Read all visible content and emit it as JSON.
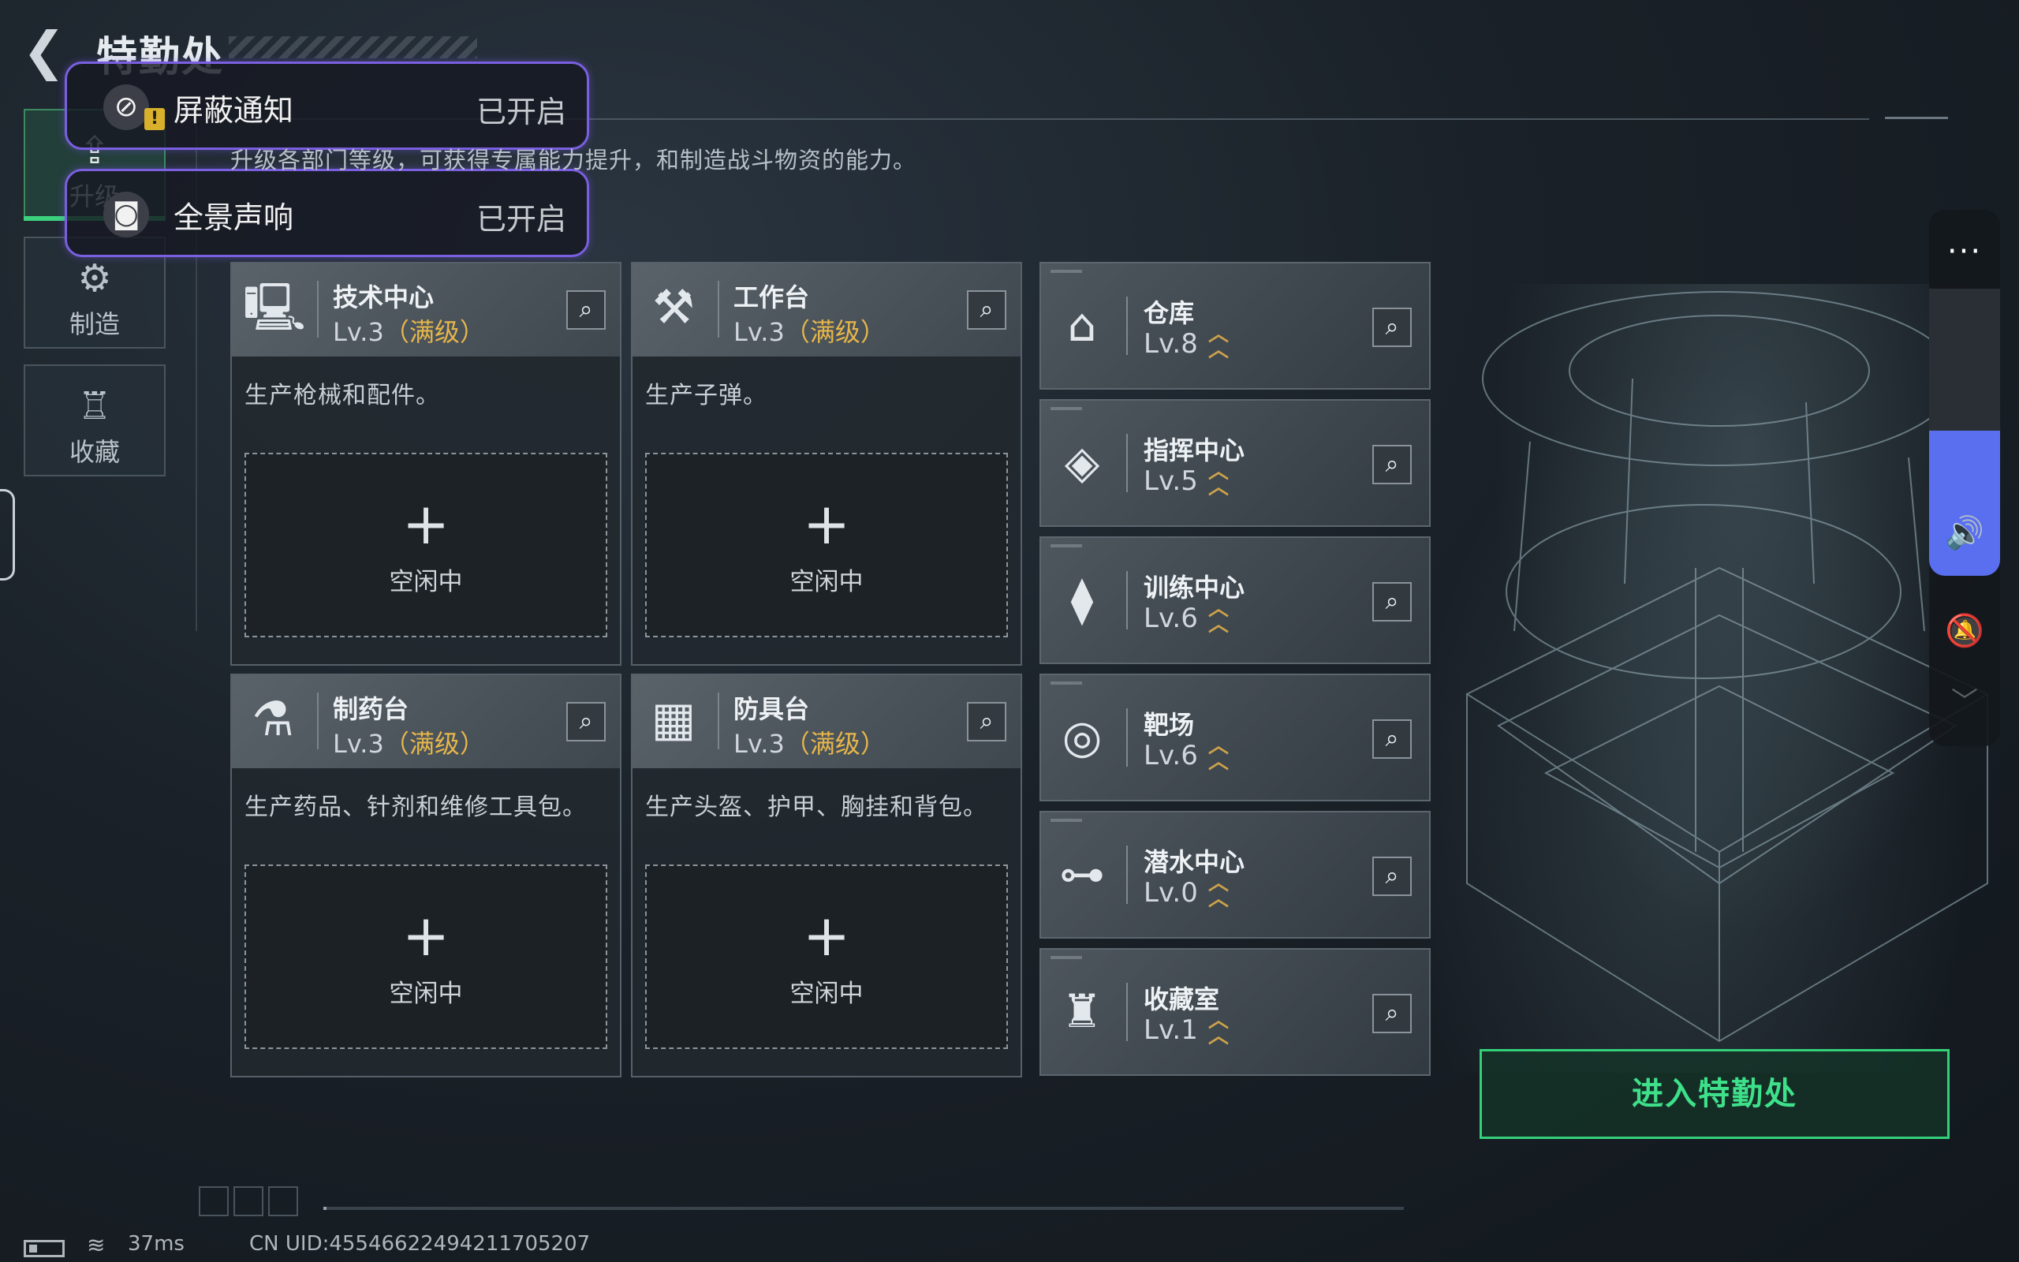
{
  "header": {
    "back_icon": "chevron-left-icon",
    "title": "特勤处"
  },
  "notifications": [
    {
      "icon": "notification-off-icon",
      "label": "屏蔽通知",
      "status": "已开启",
      "warning": "!"
    },
    {
      "icon": "speaker-icon",
      "label": "全景声响",
      "status": "已开启"
    }
  ],
  "nav": {
    "items": [
      {
        "label": "升级",
        "icon": "upgrade-icon",
        "active": true
      },
      {
        "label": "制造",
        "icon": "gears-icon",
        "active": false
      },
      {
        "label": "收藏",
        "icon": "collection-icon",
        "active": false
      }
    ]
  },
  "subtitle": "升级各部门等级，可获得专属能力提升，和制造战斗物资的能力。",
  "production": [
    {
      "name": "技术中心",
      "level": "Lv.3",
      "max": "（满级）",
      "desc": "生产枪械和配件。",
      "slot_plus": "+",
      "slot_label": "空闲中",
      "icon": "tech-center-icon"
    },
    {
      "name": "工作台",
      "level": "Lv.3",
      "max": "（满级）",
      "desc": "生产子弹。",
      "slot_plus": "+",
      "slot_label": "空闲中",
      "icon": "workbench-icon"
    },
    {
      "name": "制药台",
      "level": "Lv.3",
      "max": "（满级）",
      "desc": "生产药品、针剂和维修工具包。",
      "slot_plus": "+",
      "slot_label": "空闲中",
      "icon": "pharmacy-icon"
    },
    {
      "name": "防具台",
      "level": "Lv.3",
      "max": "（满级）",
      "desc": "生产头盔、护甲、胸挂和背包。",
      "slot_plus": "+",
      "slot_label": "空闲中",
      "icon": "armor-bench-icon"
    }
  ],
  "facilities": [
    {
      "name": "仓库",
      "level": "Lv.8",
      "icon": "warehouse-icon"
    },
    {
      "name": "指挥中心",
      "level": "Lv.5",
      "icon": "command-center-icon"
    },
    {
      "name": "训练中心",
      "level": "Lv.6",
      "icon": "dumbbell-icon"
    },
    {
      "name": "靶场",
      "level": "Lv.6",
      "icon": "target-icon"
    },
    {
      "name": "潜水中心",
      "level": "Lv.0",
      "icon": "diving-mask-icon"
    },
    {
      "name": "收藏室",
      "level": "Lv.1",
      "icon": "collection-room-icon"
    }
  ],
  "search_icon": "search-icon",
  "upgrade_arrow_icon": "upgrade-arrow-icon",
  "volume": {
    "menu": "···",
    "speaker_icon": "volume-icon",
    "mute_icon": "bell-off-icon",
    "chevron": "﹀",
    "level": 0.4
  },
  "enter_button": "进入特勤处",
  "status_bar": {
    "ping": "37ms",
    "uid": "CN UID:45546622494211705207"
  },
  "colors": {
    "accent_green": "#3ee08a",
    "max_gold": "#e6b64a",
    "volume_blue": "#5a6ff0",
    "notif_border": "#7a5fe0"
  }
}
